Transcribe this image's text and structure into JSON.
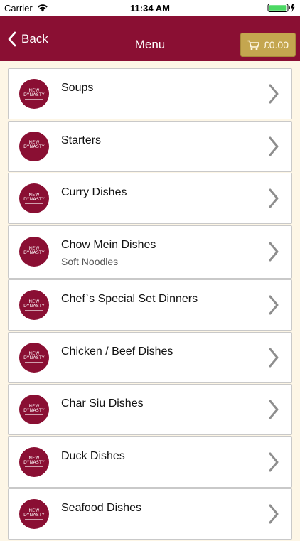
{
  "status_bar": {
    "carrier": "Carrier",
    "time": "11:34 AM"
  },
  "nav": {
    "back_label": "Back",
    "title": "Menu",
    "cart_total": "£0.00"
  },
  "logo": {
    "line1": "NEW",
    "line2": "DYNASTY"
  },
  "menu_items": [
    {
      "title": "Soups",
      "subtitle": ""
    },
    {
      "title": "Starters",
      "subtitle": ""
    },
    {
      "title": "Curry Dishes",
      "subtitle": ""
    },
    {
      "title": "Chow Mein Dishes",
      "subtitle": "Soft Noodles"
    },
    {
      "title": "Chef`s Special Set Dinners",
      "subtitle": ""
    },
    {
      "title": "Chicken / Beef Dishes",
      "subtitle": ""
    },
    {
      "title": "Char Siu Dishes",
      "subtitle": ""
    },
    {
      "title": "Duck Dishes",
      "subtitle": ""
    },
    {
      "title": "Seafood Dishes",
      "subtitle": ""
    }
  ],
  "colors": {
    "nav_background": "#8a0f33",
    "cart_button": "#c4a64f",
    "page_background": "#fdf6e6"
  },
  "icons": {
    "wifi": "wifi-icon",
    "battery": "battery-icon",
    "back": "back-chevron-icon",
    "cart": "cart-icon",
    "disclosure": "chevron-icon"
  }
}
